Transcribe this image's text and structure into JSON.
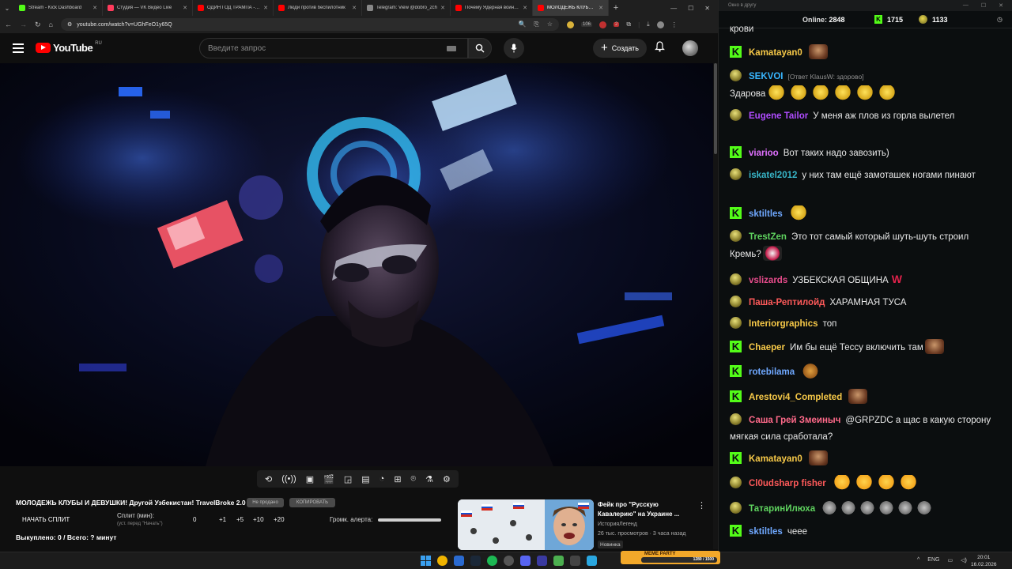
{
  "browser": {
    "tabs": [
      {
        "title": "Stream - Kick Dashboard",
        "color": "#53fc18"
      },
      {
        "title": "Студия — VK Видео Live",
        "color": "#ff3b5c"
      },
      {
        "title": "ОДИН ГОД ТРАМПА - YouT",
        "color": "#ff0000"
      },
      {
        "title": "Люди против беспилотник",
        "color": "#ff0000"
      },
      {
        "title": "Telegram: View @dobro_2ch",
        "color": "#888888"
      },
      {
        "title": "Почему Ядерная война уж",
        "color": "#ff0000"
      },
      {
        "title": "МОЛОДЕЖЬ КЛУБЫ И Д",
        "color": "#ff0000"
      }
    ],
    "url": "youtube.com/watch?v=UGhFeO1y65Q",
    "ext_badges": [
      "106",
      "2"
    ]
  },
  "youtube": {
    "logo_text": "YouTube",
    "logo_region": "RU",
    "search_placeholder": "Введите запрос",
    "create_label": "Создать"
  },
  "player": {
    "title": "МОЛОДЕЖЬ КЛУБЫ И ДЕВУШКИ! Другой Узбекистан! TravelBroke 2.0",
    "btn_no_order": "Не продано",
    "btn_copy": "КОПИРОВАТЬ",
    "split_button": "НАЧАТЬ СПЛИТ",
    "split_label": "Сплит (мин):",
    "split_hint": "(уст. перед \"Начать\")",
    "split_values": [
      "0",
      "+1",
      "+5",
      "+10",
      "+20"
    ],
    "alert_volume_label": "Громк. алерта:",
    "alert_volume_level": 1.0,
    "bought_text": "Выкуплено: 0 / Всего: ? минут"
  },
  "recommended": {
    "title": "Фейк про \"Русскую Кавалерию\" на Украине ...",
    "channel": "ИсторияЛегенд",
    "meta": "26 тыс. просмотров · 3 часа назад",
    "badge": "Новинка"
  },
  "chat": {
    "window_title": "Окно в другу",
    "online_label": "Online:",
    "online_count": "2848",
    "kick_count": "1715",
    "points_count": "1133",
    "messages": [
      {
        "badge": "none",
        "user": "",
        "reply": "",
        "text": "крови",
        "emotes": [],
        "color": "#e8e8e8"
      },
      {
        "badge": "k",
        "user": "Kamatayan0",
        "reply": "",
        "text": "",
        "emotes": [
          "em-face"
        ],
        "color": "#f7c948"
      },
      {
        "badge": "p",
        "user": "SEKVOI",
        "reply": "[Ответ KlausW: здорово]",
        "text": "Здарова",
        "emotes": [
          "em-yellow",
          "em-yellow",
          "em-yellow",
          "em-yellow",
          "em-yellow",
          "em-yellow"
        ],
        "color": "#38b6ff"
      },
      {
        "badge": "p",
        "user": "Eugene Tailor",
        "reply": "",
        "text": "У меня аж плов из горла вылетел",
        "emotes": [],
        "color": "#b04cff"
      },
      {
        "badge": "k",
        "user": "viarioo",
        "reply": "",
        "text": "Вот таких надо завозить)",
        "emotes": [],
        "color": "#e070ff"
      },
      {
        "badge": "p",
        "user": "iskatel2012",
        "reply": "",
        "text": "у них там ещё замоташек ногами пинают",
        "emotes": [],
        "color": "#38b6c8"
      },
      {
        "badge": "k",
        "user": "sktiltles",
        "reply": "",
        "text": "",
        "emotes": [
          "em-yellow"
        ],
        "color": "#6fa8ff"
      },
      {
        "badge": "p",
        "user": "TrestZen",
        "reply": "",
        "text": "Это тот самый который шуть-шуть строил Кремь?",
        "emotes": [
          "em-clown"
        ],
        "color": "#5fd35f"
      },
      {
        "badge": "p",
        "user": "vslizards",
        "reply": "",
        "text": "УЗБЕКСКАЯ ОБЩИНА",
        "emotes": [],
        "w": "W",
        "color": "#e74c8c"
      },
      {
        "badge": "p",
        "user": "Паша-Рептилойд",
        "reply": "",
        "text": "ХАРАМНАЯ ТУСА",
        "emotes": [],
        "color": "#ff5a5a"
      },
      {
        "badge": "p",
        "user": "Interiorgraphics",
        "reply": "",
        "text": "топ",
        "emotes": [],
        "color": "#f7c948"
      },
      {
        "badge": "k",
        "user": "Chaeper",
        "reply": "",
        "text": "Им бы ещё Тессу включить там",
        "emotes": [
          "em-face"
        ],
        "color": "#f7c948"
      },
      {
        "badge": "k",
        "user": "rotebilama",
        "reply": "",
        "text": "",
        "emotes": [
          "em-kitten"
        ],
        "color": "#6fa8ff"
      },
      {
        "badge": "k",
        "user": "Arestovi4_Completed",
        "reply": "",
        "text": "",
        "emotes": [
          "em-face"
        ],
        "color": "#f7c948"
      },
      {
        "badge": "p",
        "user": "Саша Грей Змеиныч",
        "reply": "",
        "text": "@GRPZDC а щас в какую сторону мягкая сила сработала?",
        "emotes": [],
        "color": "#ff6a8a"
      },
      {
        "badge": "k",
        "user": "Kamatayan0",
        "reply": "",
        "text": "",
        "emotes": [
          "em-face"
        ],
        "color": "#f7c948"
      },
      {
        "badge": "p",
        "user": "Cl0udsharp fisher",
        "reply": "",
        "text": "",
        "emotes": [
          "em-laugh",
          "em-laugh",
          "em-laugh",
          "em-laugh"
        ],
        "color": "#ff5a5a"
      },
      {
        "badge": "p",
        "user": "ТатаринИлюха",
        "reply": "",
        "text": "",
        "emotes": [
          "em-cat",
          "em-cat",
          "em-cat",
          "em-cat",
          "em-cat",
          "em-cat"
        ],
        "color": "#5fd35f"
      },
      {
        "badge": "k",
        "user": "sktiltles",
        "reply": "",
        "text": "чеее",
        "emotes": [],
        "color": "#6fa8ff"
      }
    ]
  },
  "taskbar": {
    "meme_party_label": "MEME PARTY",
    "meme_party_value": "1280 / 1500",
    "lang": "ENG",
    "time": "20:01",
    "date": "16.02.2026"
  },
  "colors": {
    "kick_green": "#53fc18",
    "yt_red": "#ff0000",
    "chat_bg": "#0b0e0f"
  }
}
